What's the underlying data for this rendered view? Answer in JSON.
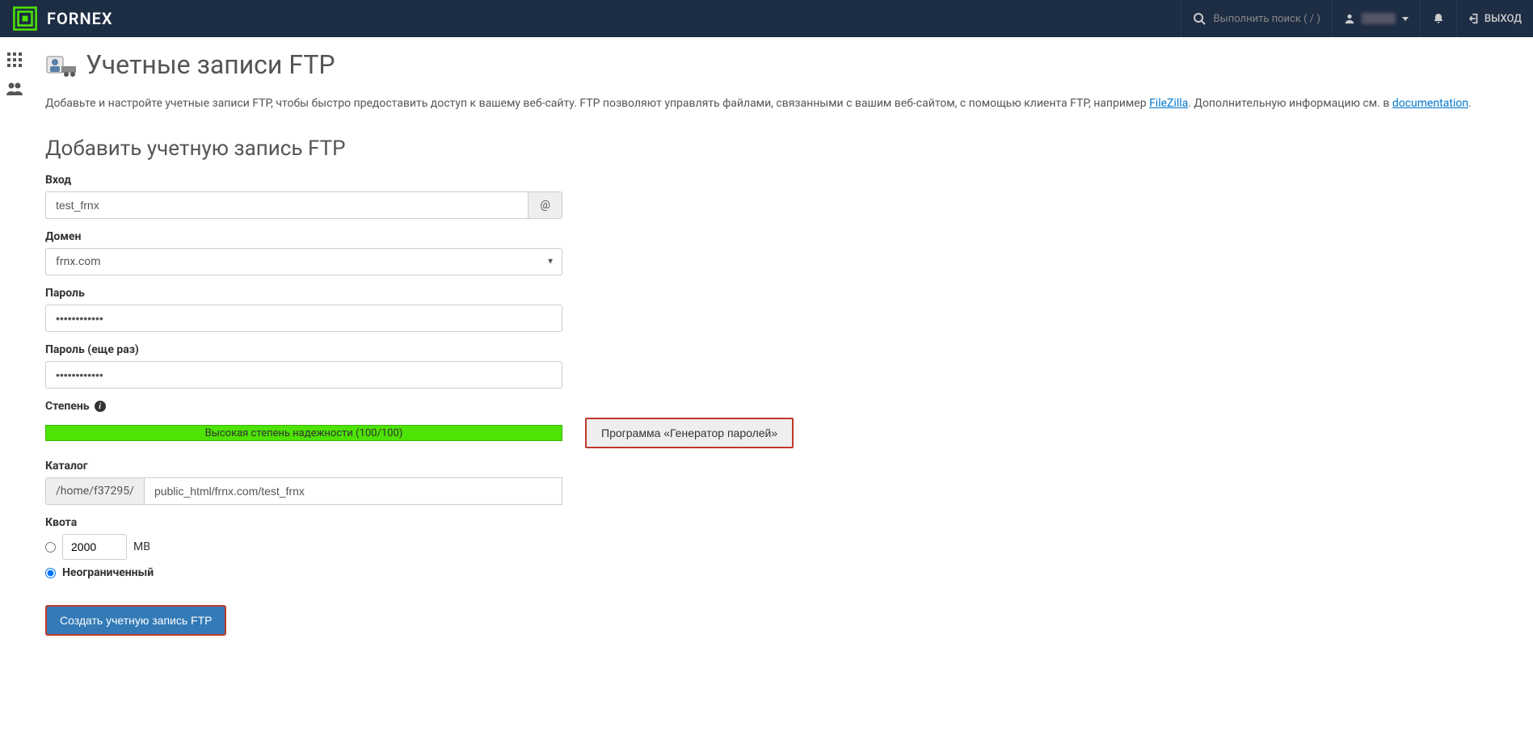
{
  "header": {
    "brand": "FORNEX",
    "search_placeholder": "Выполнить поиск ( / )",
    "logout": "ВЫХОД"
  },
  "page": {
    "title": "Учетные записи FTP",
    "intro_1": "Добавьте и настройте учетные записи FTP, чтобы быстро предоставить доступ к вашему веб-сайту. FTP позволяют управлять файлами, связанными с вашим веб-сайтом, с помощью клиента FTP, например ",
    "intro_link1": "FileZilla",
    "intro_2": ". Дополнительную информацию см. в ",
    "intro_link2": "documentation",
    "intro_3": "."
  },
  "form": {
    "section_title": "Добавить учетную запись FTP",
    "login_label": "Вход",
    "login_value": "test_frnx",
    "at_symbol": "@",
    "domain_label": "Домен",
    "domain_value": "frnx.com",
    "password_label": "Пароль",
    "password_value": "••••••••••••",
    "password2_label": "Пароль (еще раз)",
    "password2_value": "••••••••••••",
    "strength_label": "Степень",
    "strength_text": "Высокая степень надежности (100/100)",
    "gen_pwd": "Программа «Генератор паролей»",
    "dir_label": "Каталог",
    "dir_prefix": "/home/f37295/",
    "dir_value": "public_html/frnx.com/test_frnx",
    "quota_label": "Квота",
    "quota_value": "2000",
    "quota_unit": "МВ",
    "quota_unlimited": "Неограниченный",
    "submit": "Создать учетную запись FTP"
  }
}
